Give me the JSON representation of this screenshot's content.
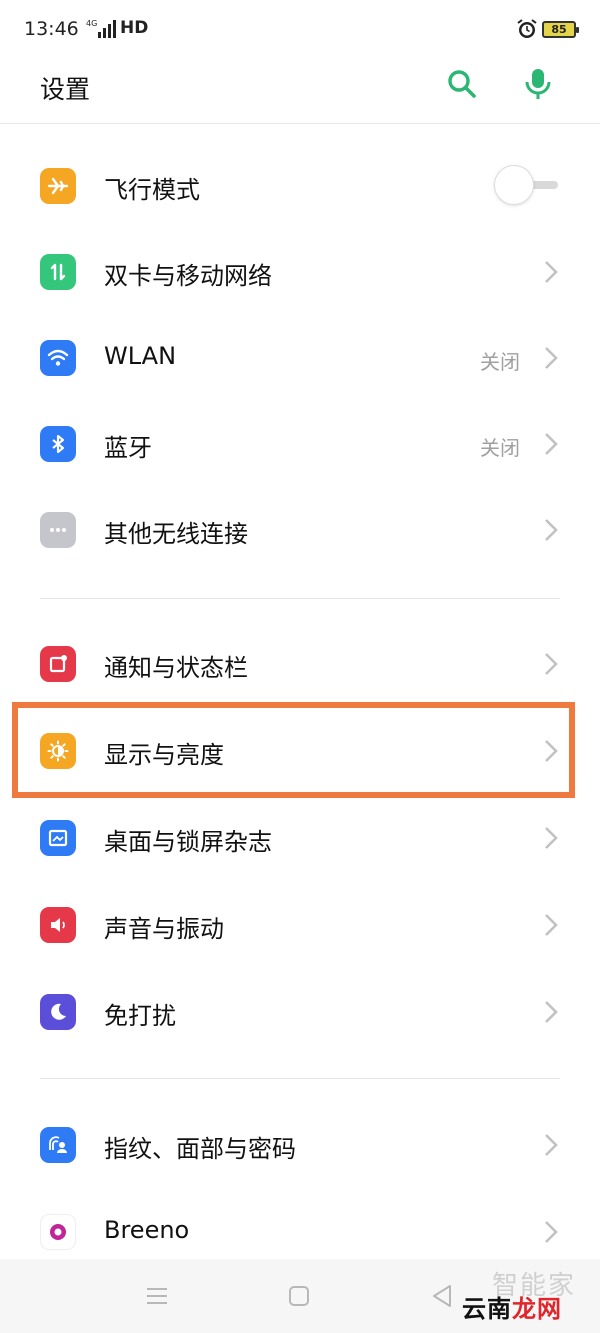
{
  "status_bar": {
    "time": "13:46",
    "network": "4G",
    "hd": "HD",
    "battery": "85"
  },
  "header": {
    "title": "设置",
    "accent_color": "#2bb673"
  },
  "settings": [
    {
      "label": "飞行模式",
      "icon": "airplane-icon",
      "color": "#f5a623",
      "toggle": false
    },
    {
      "label": "双卡与移动网络",
      "icon": "dual-sim-icon",
      "color": "#34c77b"
    },
    {
      "label": "WLAN",
      "icon": "wifi-icon",
      "color": "#2f7bf5",
      "value": "关闭"
    },
    {
      "label": "蓝牙",
      "icon": "bluetooth-icon",
      "color": "#2f7bf5",
      "value": "关闭"
    },
    {
      "label": "其他无线连接",
      "icon": "more-dots-icon",
      "color": "#c4c6cc"
    },
    {
      "label": "通知与状态栏",
      "icon": "notification-icon",
      "color": "#e5394a"
    },
    {
      "label": "显示与亮度",
      "icon": "brightness-icon",
      "color": "#f5a623",
      "highlighted": true
    },
    {
      "label": "桌面与锁屏杂志",
      "icon": "wallpaper-icon",
      "color": "#2f7bf5"
    },
    {
      "label": "声音与振动",
      "icon": "speaker-icon",
      "color": "#e5394a"
    },
    {
      "label": "免打扰",
      "icon": "moon-icon",
      "color": "#5b4fd9"
    },
    {
      "label": "指纹、面部与密码",
      "icon": "fingerprint-face-icon",
      "color": "#2f7bf5"
    },
    {
      "label": "Breeno",
      "icon": "breeno-icon",
      "color": "#c0259a"
    }
  ],
  "watermark": {
    "top": "智能家",
    "main_part1": "云南",
    "main_part2": "龙网"
  }
}
